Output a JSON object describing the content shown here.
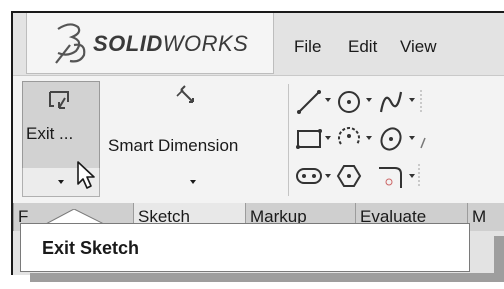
{
  "app": {
    "brand_prefix": "3S",
    "brand_bold": "SOLID",
    "brand_light": "WORKS"
  },
  "menu": {
    "items": [
      "File",
      "Edit",
      "View"
    ]
  },
  "toolbar": {
    "exit_label": "Exit ...",
    "smart_dimension_label": "Smart Dimension"
  },
  "tabs": [
    {
      "label": "F"
    },
    {
      "label": "Sketch"
    },
    {
      "label": "Markup"
    },
    {
      "label": "Evaluate"
    },
    {
      "label": "M"
    }
  ],
  "tooltip": {
    "text": "Exit Sketch"
  },
  "icons": [
    "exit-sketch-icon",
    "smart-dimension-icon",
    "line-icon",
    "circle-icon",
    "spline-icon",
    "rectangle-icon",
    "arc-icon",
    "ellipse-icon",
    "slot-icon",
    "polygon-icon",
    "fillet-icon"
  ]
}
